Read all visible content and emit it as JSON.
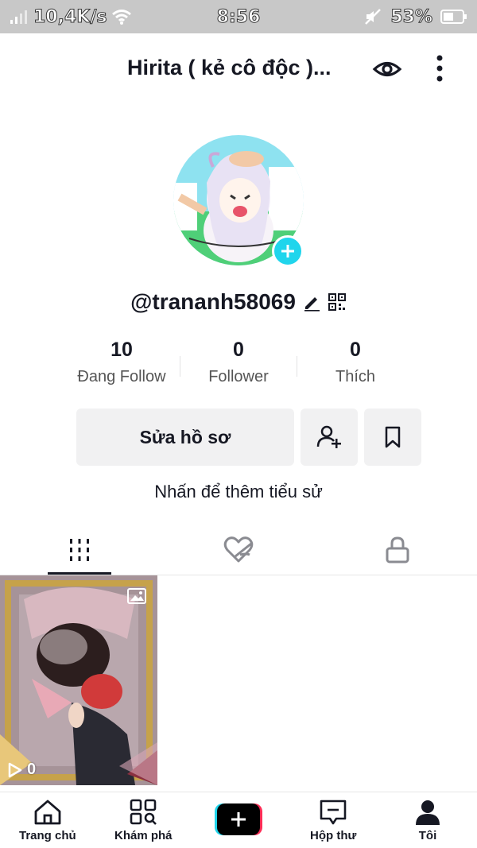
{
  "status_bar": {
    "network_speed": "10,4K/s",
    "time": "8:56",
    "battery": "53%"
  },
  "header": {
    "profile_name": "Hirita ( kẻ cô độc )..."
  },
  "profile": {
    "username": "@trananh58069",
    "stats": [
      {
        "value": "10",
        "label": "Đang Follow"
      },
      {
        "value": "0",
        "label": "Follower"
      },
      {
        "value": "0",
        "label": "Thích"
      }
    ],
    "edit_button": "Sửa hồ sơ",
    "bio_prompt": "Nhấn để thêm tiểu sử"
  },
  "tabs": [
    {
      "name": "videos",
      "icon": "grid-icon",
      "selected": true
    },
    {
      "name": "liked",
      "icon": "heart-hidden-icon",
      "selected": false
    },
    {
      "name": "private",
      "icon": "lock-icon",
      "selected": false
    }
  ],
  "videos": [
    {
      "views": "0"
    }
  ],
  "bottom_nav": {
    "home": "Trang chủ",
    "discover": "Khám phá",
    "inbox": "Hộp thư",
    "me": "Tôi"
  },
  "colors": {
    "accent_cyan": "#20d5ec",
    "accent_pink": "#fe2c55",
    "text": "#161823"
  }
}
